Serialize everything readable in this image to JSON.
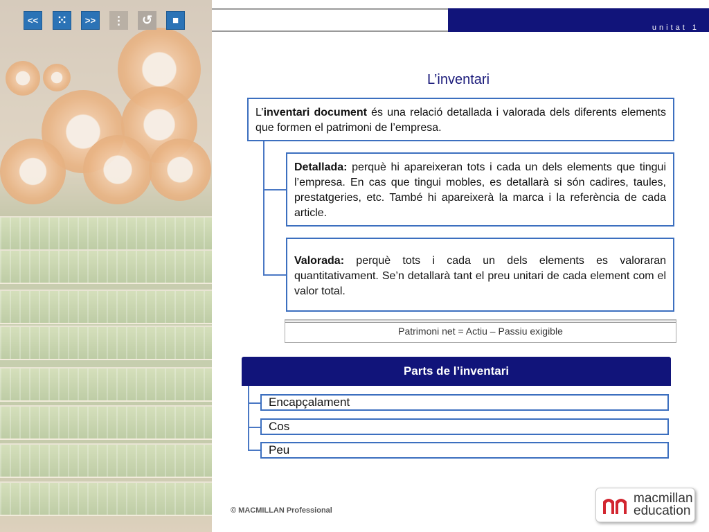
{
  "header": {
    "unit_label": "unitat 1",
    "nav": {
      "prev_label": "<<",
      "menu_label": "⁙",
      "next_label": ">>",
      "index_label": "⋮",
      "back_label": "↺",
      "stop_label": "■"
    }
  },
  "main": {
    "title": "L’inventari",
    "definition": {
      "prefix": "L’",
      "bold": "inventari document",
      "rest": " és una relació detallada i valorada dels diferents elements que formen el patrimoni de l’empresa."
    },
    "detallada": {
      "bold": "Detallada:",
      "rest": " perquè hi apareixeran tots i cada un dels elements que tingui l’empresa. En cas que tingui mobles, es detallarà si són cadires, taules, prestatgeries, etc. També hi apareixerà la marca i la referència de cada article."
    },
    "valorada": {
      "bold": "Valorada:",
      "rest": " perquè tots i cada un dels elements es valoraran quantitativament. Se’n detallarà tant el preu unitari de cada element com el valor total."
    },
    "formula": "Patrimoni net = Actiu – Passiu exigible",
    "parts": {
      "header": "Parts de l’inventari",
      "items": [
        "Encapçalament",
        "Cos",
        "Peu"
      ]
    }
  },
  "footer": {
    "copyright": "© MACMILLAN Professional",
    "logo_line1": "macmillan",
    "logo_line2": "education"
  },
  "colors": {
    "navy": "#11147a",
    "box_border": "#3c6fbf",
    "button_blue": "#2b73b6",
    "logo_red": "#d22630"
  }
}
